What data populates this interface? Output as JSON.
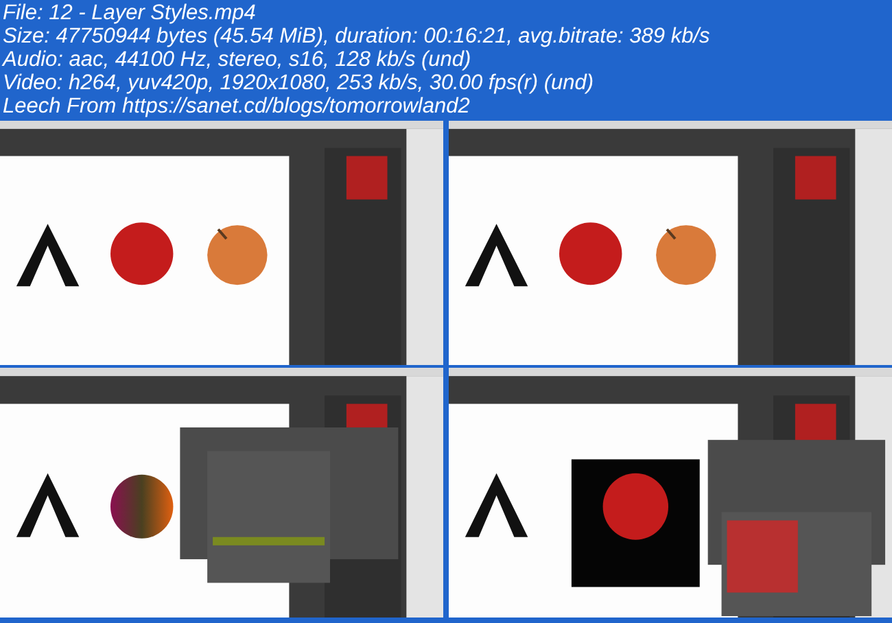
{
  "info_lines": [
    "File: 12 - Layer Styles.mp4",
    "Size: 47750944 bytes (45.54 MiB), duration: 00:16:21, avg.bitrate: 389 kb/s",
    "Audio: aac, 44100 Hz, stereo, s16, 128 kb/s (und)",
    "Video: h264, yuv420p, 1920x1080, 253 kb/s, 30.00 fps(r) (und)",
    "Leech From https://sanet.cd/blogs/tomorrowland2"
  ]
}
